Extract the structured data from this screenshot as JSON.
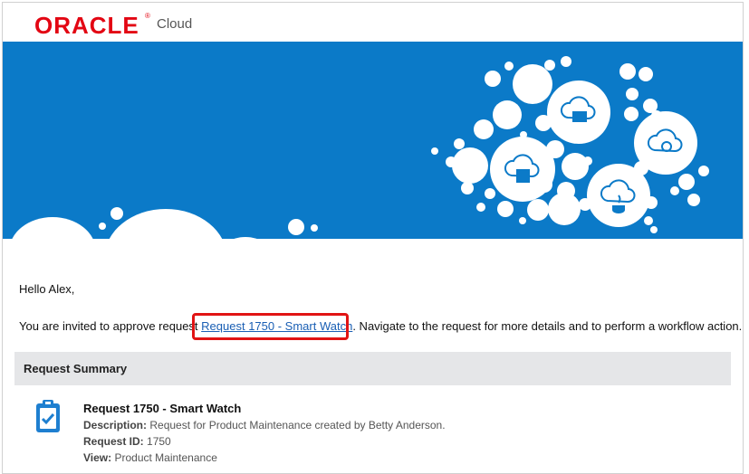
{
  "header": {
    "brand": "ORACLE",
    "brand_mark": "®",
    "product": "Cloud"
  },
  "colors": {
    "brand_red": "#e30613",
    "banner_blue": "#0b7ac8",
    "link_blue": "#1a5fb4",
    "highlight_red": "#e11414",
    "summary_bg": "#e5e6e8"
  },
  "banner": {
    "icons": [
      "server-cloud-icon",
      "database-cloud-icon",
      "sync-cloud-icon",
      "java-cloud-icon"
    ]
  },
  "message": {
    "greeting": "Hello Alex,",
    "invite_prefix": "You are invited to approve request",
    "request_link": "Request 1750 - Smart Watch",
    "invite_suffix": ". Navigate to the request for more details and to perform a workflow action."
  },
  "summary": {
    "heading": "Request Summary",
    "request_title": "Request 1750 - Smart Watch",
    "fields": [
      {
        "label": "Description:",
        "value": "Request for Product Maintenance created by Betty Anderson."
      },
      {
        "label": "Request ID:",
        "value": "1750"
      },
      {
        "label": "View:",
        "value": "Product Maintenance"
      }
    ]
  }
}
